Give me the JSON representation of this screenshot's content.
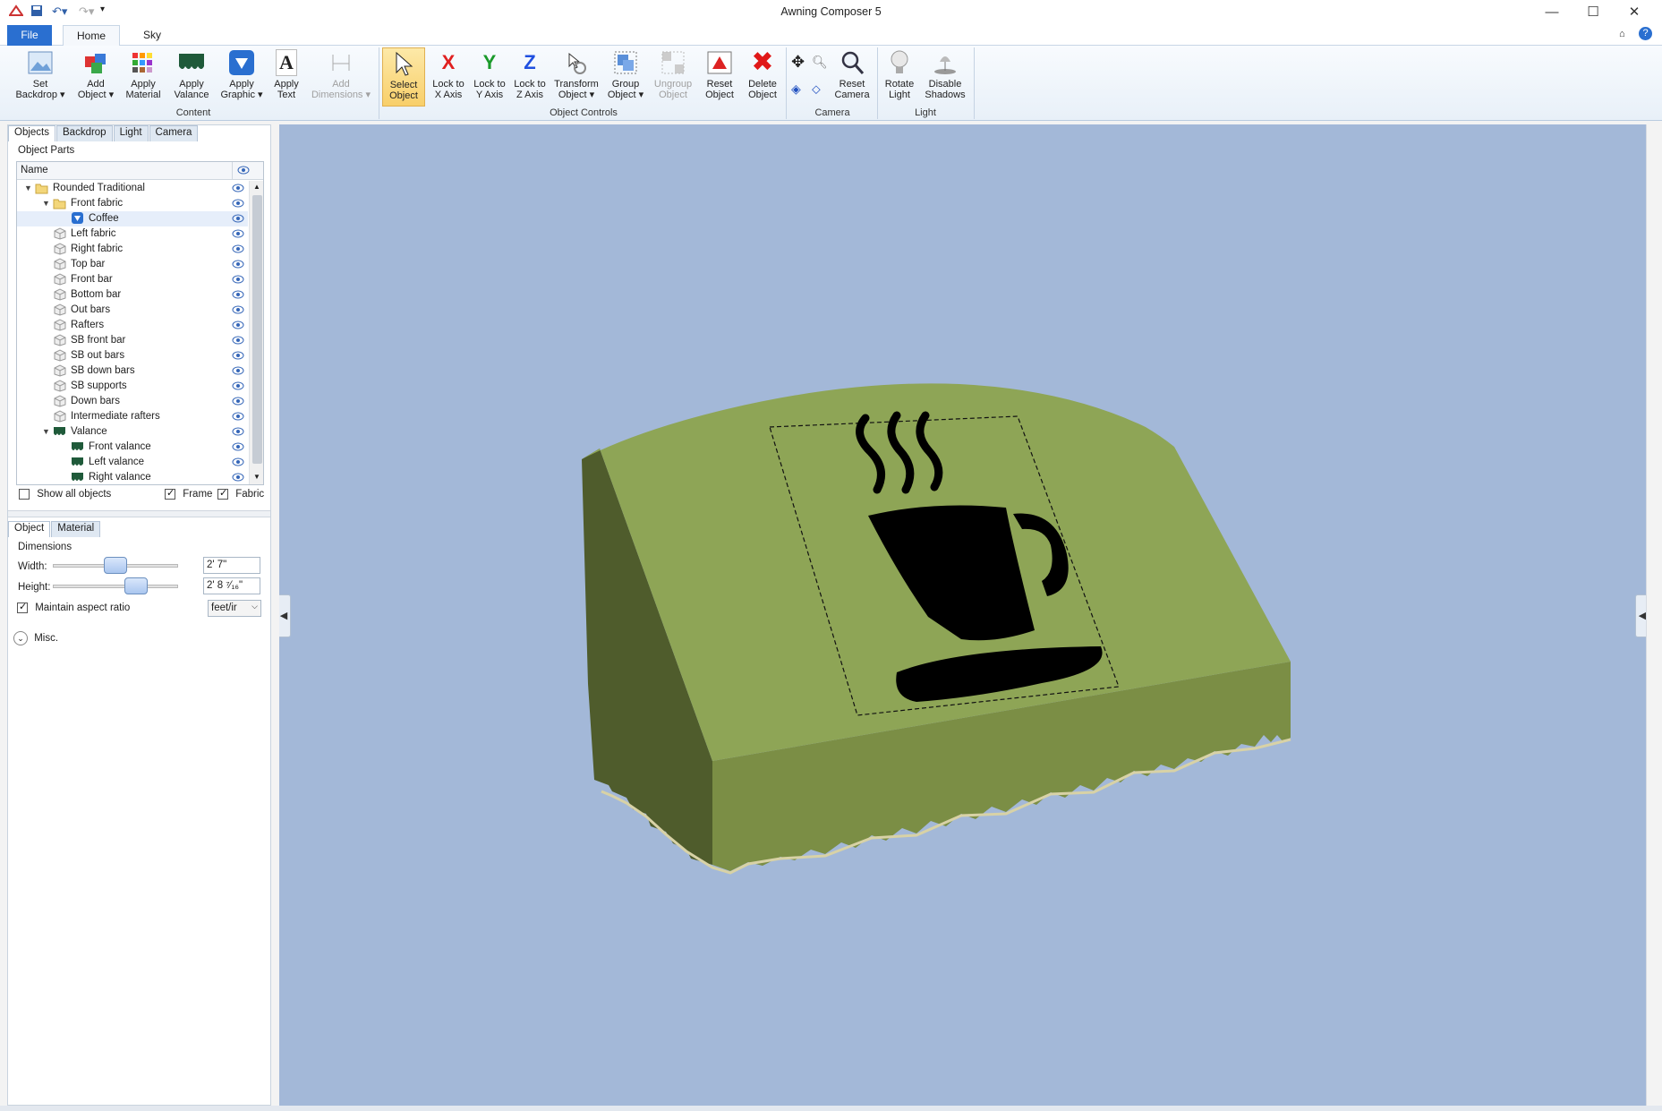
{
  "window": {
    "title": "Awning Composer 5"
  },
  "quick_access": [
    "app-logo-icon",
    "save-icon",
    "undo-icon",
    "redo-icon",
    "customize-icon"
  ],
  "ribbon_tabs": [
    "File",
    "Home",
    "Sky"
  ],
  "ribbon": {
    "content": {
      "label": "Content",
      "buttons": [
        {
          "line1": "Set",
          "line2": "Backdrop ▾"
        },
        {
          "line1": "Add",
          "line2": "Object ▾"
        },
        {
          "line1": "Apply",
          "line2": "Material"
        },
        {
          "line1": "Apply",
          "line2": "Valance"
        },
        {
          "line1": "Apply",
          "line2": "Graphic ▾"
        },
        {
          "line1": "Apply",
          "line2": "Text"
        },
        {
          "line1": "Add",
          "line2": "Dimensions ▾"
        }
      ]
    },
    "object_controls": {
      "label": "Object Controls",
      "buttons": [
        {
          "line1": "Select",
          "line2": "Object"
        },
        {
          "line1": "Lock to",
          "line2": "X Axis",
          "glyph": "X"
        },
        {
          "line1": "Lock to",
          "line2": "Y Axis",
          "glyph": "Y"
        },
        {
          "line1": "Lock to",
          "line2": "Z Axis",
          "glyph": "Z"
        },
        {
          "line1": "Transform",
          "line2": "Object ▾"
        },
        {
          "line1": "Group",
          "line2": "Object ▾"
        },
        {
          "line1": "Ungroup",
          "line2": "Object"
        },
        {
          "line1": "Reset",
          "line2": "Object"
        },
        {
          "line1": "Delete",
          "line2": "Object"
        }
      ]
    },
    "camera": {
      "label": "Camera",
      "buttons": [
        {
          "line1": "Reset",
          "line2": "Camera"
        }
      ]
    },
    "light": {
      "label": "Light",
      "buttons": [
        {
          "line1": "Rotate",
          "line2": "Light"
        },
        {
          "line1": "Disable",
          "line2": "Shadows"
        }
      ]
    }
  },
  "panel_tabs": [
    "Objects",
    "Backdrop",
    "Light",
    "Camera"
  ],
  "object_parts": {
    "title": "Object Parts",
    "column_name": "Name",
    "items": [
      {
        "label": "Rounded Traditional",
        "level": 0,
        "expander": "▼",
        "icon": "folder-icon"
      },
      {
        "label": "Front fabric",
        "level": 1,
        "expander": "▼",
        "icon": "folder-icon"
      },
      {
        "label": "Coffee",
        "level": 2,
        "expander": "",
        "icon": "graphic-icon"
      },
      {
        "label": "Left fabric",
        "level": 1,
        "expander": "",
        "icon": "part-icon"
      },
      {
        "label": "Right fabric",
        "level": 1,
        "expander": "",
        "icon": "part-icon"
      },
      {
        "label": "Top bar",
        "level": 1,
        "expander": "",
        "icon": "part-icon"
      },
      {
        "label": "Front bar",
        "level": 1,
        "expander": "",
        "icon": "part-icon"
      },
      {
        "label": "Bottom bar",
        "level": 1,
        "expander": "",
        "icon": "part-icon"
      },
      {
        "label": "Out bars",
        "level": 1,
        "expander": "",
        "icon": "part-icon"
      },
      {
        "label": "Rafters",
        "level": 1,
        "expander": "",
        "icon": "part-icon"
      },
      {
        "label": "SB front bar",
        "level": 1,
        "expander": "",
        "icon": "part-icon"
      },
      {
        "label": "SB out bars",
        "level": 1,
        "expander": "",
        "icon": "part-icon"
      },
      {
        "label": "SB down bars",
        "level": 1,
        "expander": "",
        "icon": "part-icon"
      },
      {
        "label": "SB supports",
        "level": 1,
        "expander": "",
        "icon": "part-icon"
      },
      {
        "label": "Down bars",
        "level": 1,
        "expander": "",
        "icon": "part-icon"
      },
      {
        "label": "Intermediate rafters",
        "level": 1,
        "expander": "",
        "icon": "part-icon"
      },
      {
        "label": "Valance",
        "level": 1,
        "expander": "▼",
        "icon": "valance-icon"
      },
      {
        "label": "Front valance",
        "level": 2,
        "expander": "",
        "icon": "valance-icon"
      },
      {
        "label": "Left valance",
        "level": 2,
        "expander": "",
        "icon": "valance-icon"
      },
      {
        "label": "Right valance",
        "level": 2,
        "expander": "",
        "icon": "valance-icon"
      }
    ],
    "selected": "Coffee",
    "show_all_label": "Show all objects",
    "frame_label": "Frame",
    "fabric_label": "Fabric"
  },
  "props_tabs": [
    "Object",
    "Material"
  ],
  "dimensions": {
    "title": "Dimensions",
    "width_label": "Width:",
    "width_value": "2' 7\"",
    "height_label": "Height:",
    "height_value": "2' 8 ⁷⁄₁₆\"",
    "maintain_label": "Maintain aspect ratio",
    "units": "feet/ir",
    "width_slider": 0.5,
    "height_slider": 0.7
  },
  "misc_label": "Misc.",
  "colors": {
    "awning_top": "#8ea556",
    "awning_front": "#7b8e45",
    "awning_side": "#4f5c2c",
    "sky": "#a3b8d8",
    "accent": "#2a6fd0"
  }
}
